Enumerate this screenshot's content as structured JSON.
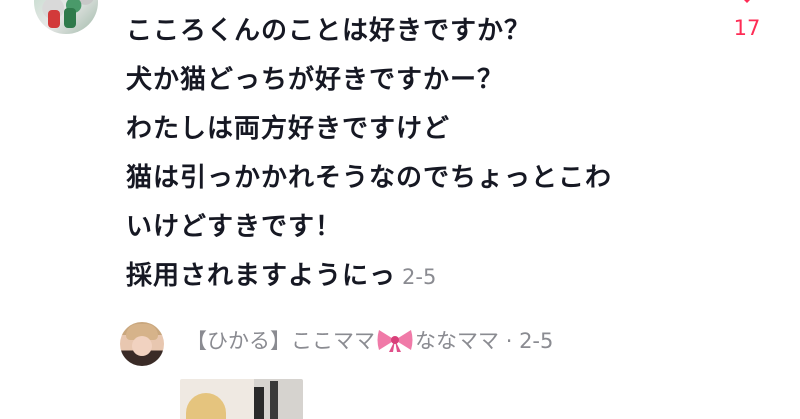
{
  "comment": {
    "lines": [
      "こころくんのことは好きですか？",
      "犬か猫どっちが好きですかー？",
      "わたしは両方好きですけど",
      "猫は引っかかれそうなのでちょっとこわ",
      "いけどすきです！",
      "採用されますようにっ"
    ],
    "time": "2-5",
    "like_icon": "heart-icon",
    "like_count": "17"
  },
  "reply": {
    "author_prefix": "【ひかる】ここママ",
    "author_emoji": "ribbon-icon",
    "author_suffix": "ななママ",
    "separator": "·",
    "time": "2-5"
  },
  "colors": {
    "text": "#161823",
    "meta": "#8a8b91",
    "like": "#fe2c55"
  }
}
